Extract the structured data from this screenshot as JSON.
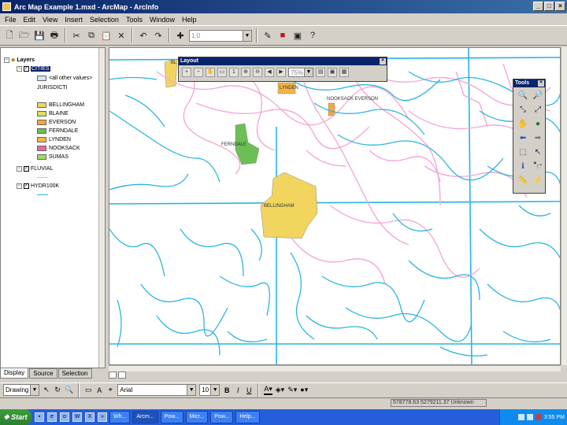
{
  "window": {
    "title": "Arc Map Example 1.mxd - ArcMap - ArcInfo",
    "buttons": [
      "_",
      "□",
      "×"
    ]
  },
  "menu": [
    "File",
    "Edit",
    "View",
    "Insert",
    "Selection",
    "Tools",
    "Window",
    "Help"
  ],
  "toolbar": {
    "scale": "1:0"
  },
  "toc": {
    "root": "Layers",
    "layers": [
      {
        "name": "CITIES",
        "expanded": true,
        "checked": true,
        "selected": true,
        "legend": [
          {
            "label": "<all other values>",
            "color": "#cfe4f1"
          },
          {
            "label": "JURISDICTI",
            "color": ""
          },
          {
            "label": "BELLINGHAM",
            "color": "#f1d55e"
          },
          {
            "label": "BLAINE",
            "color": "#d9e060"
          },
          {
            "label": "EVERSON",
            "color": "#f2a83e"
          },
          {
            "label": "FERNDALE",
            "color": "#6cbf55"
          },
          {
            "label": "LYNDEN",
            "color": "#f4b342"
          },
          {
            "label": "NOOKSACK",
            "color": "#e86a9a"
          },
          {
            "label": "SUMAS",
            "color": "#9edb60"
          }
        ]
      },
      {
        "name": "FLUVIAL",
        "expanded": true,
        "checked": true,
        "line_color": "#f2a6d4"
      },
      {
        "name": "HYDR100K",
        "expanded": true,
        "checked": true,
        "line_color": "#27b5e0"
      }
    ],
    "tabs": [
      "Display",
      "Source",
      "Selection"
    ]
  },
  "map": {
    "labels": [
      "BL",
      "LYNDEN",
      "NOOKSACK EVERSON",
      "FERNDALE",
      "BELLINGHAM"
    ],
    "colors": {
      "water": "#2bb5e0",
      "fluvial": "#f3a9d6",
      "city_yellow": "#f1d55e",
      "city_green": "#6cbf55"
    }
  },
  "layout_toolbar": {
    "title": "Layout",
    "zoom": "75%"
  },
  "tools_toolbar": {
    "title": "Tools"
  },
  "drawing": {
    "label": "Drawing",
    "font": "Arial",
    "size": "10",
    "bold": "B",
    "italic": "I",
    "underline": "U",
    "text_tool": "A"
  },
  "status": {
    "coords": "578778.63  5279211.37  Unknown"
  },
  "taskbar": {
    "start": "Start",
    "tasks": [
      "Wh...",
      "Arcm...",
      "Pow...",
      "Micr...",
      "Pow...",
      "Help..."
    ],
    "clock": "3:55 PM"
  }
}
